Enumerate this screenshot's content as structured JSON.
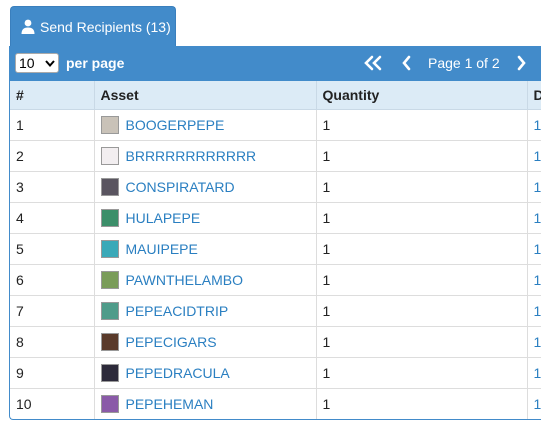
{
  "tab": {
    "label": "Send Recipients (13)"
  },
  "toolbar": {
    "per_page_value": "10",
    "per_page_label": "per page",
    "page_label": "Page 1 of 2"
  },
  "table": {
    "columns": [
      "#",
      "Asset",
      "Quantity",
      "D"
    ],
    "rows": [
      {
        "num": "1",
        "asset": "BOOGERPEPE",
        "quantity": "1",
        "d": "1",
        "thumb_color": "#c9c2b8"
      },
      {
        "num": "2",
        "asset": "BRRRRRRRRRRRR",
        "quantity": "1",
        "d": "1",
        "thumb_color": "#f2eef0"
      },
      {
        "num": "3",
        "asset": "CONSPIRATARD",
        "quantity": "1",
        "d": "1",
        "thumb_color": "#5a5560"
      },
      {
        "num": "4",
        "asset": "HULAPEPE",
        "quantity": "1",
        "d": "1",
        "thumb_color": "#3c8f6a"
      },
      {
        "num": "5",
        "asset": "MAUIPEPE",
        "quantity": "1",
        "d": "1",
        "thumb_color": "#3aa9b8"
      },
      {
        "num": "6",
        "asset": "PAWNTHELAMBO",
        "quantity": "1",
        "d": "1",
        "thumb_color": "#7a9c5a"
      },
      {
        "num": "7",
        "asset": "PEPEACIDTRIP",
        "quantity": "1",
        "d": "1",
        "thumb_color": "#4f9c8a"
      },
      {
        "num": "8",
        "asset": "PEPECIGARS",
        "quantity": "1",
        "d": "1",
        "thumb_color": "#5a3a2a"
      },
      {
        "num": "9",
        "asset": "PEPEDRACULA",
        "quantity": "1",
        "d": "1",
        "thumb_color": "#2c2a3a"
      },
      {
        "num": "10",
        "asset": "PEPEHEMAN",
        "quantity": "1",
        "d": "1",
        "thumb_color": "#8a5aa8"
      }
    ]
  }
}
